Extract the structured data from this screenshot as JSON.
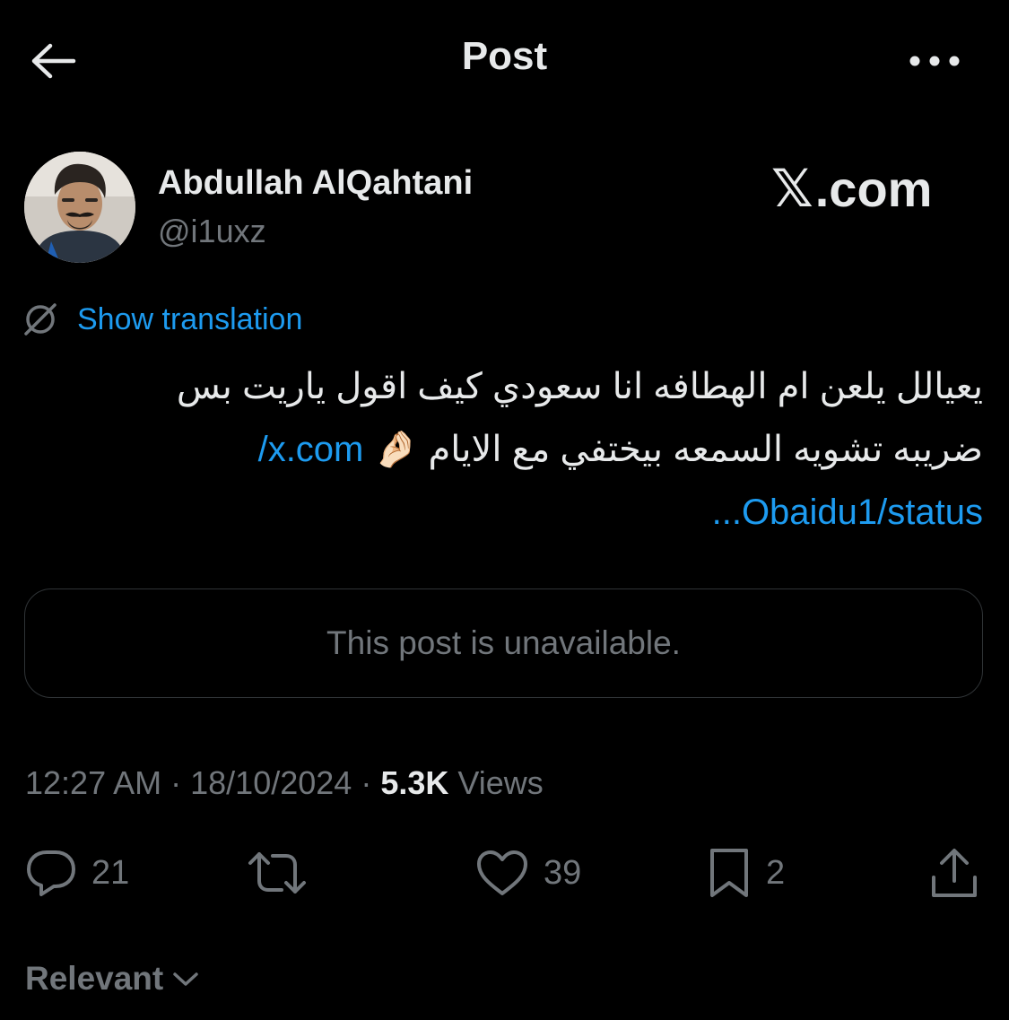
{
  "header": {
    "title": "Post",
    "back_icon": "arrow-left-icon",
    "more_icon": "more-horizontal-icon"
  },
  "author": {
    "name": "Abdullah AlQahtani",
    "handle": "@i1uxz"
  },
  "watermark": {
    "mark": "𝕏",
    "text": ".com"
  },
  "translation": {
    "label": "Show translation",
    "icon": "globe-icon"
  },
  "post": {
    "line1": "يعيالل يلعن ام الهطافه انا سعودي كيف اقول ياريت بس",
    "line2_text": "ضريبه تشويه السمعه بيختفي مع الايام",
    "emoji": "🤌🏻",
    "link_part1": "x.com/",
    "link_part2": "Obaidu1/status...",
    "unavailable": "This post is unavailable."
  },
  "meta": {
    "time": "12:27 AM",
    "separator": "·",
    "date": "18/10/2024",
    "views_count": "5.3K",
    "views_label": "Views"
  },
  "actions": {
    "replies": "21",
    "reposts": "",
    "likes": "39",
    "bookmarks": "2"
  },
  "sort": {
    "label": "Relevant"
  },
  "colors": {
    "background": "#000000",
    "text": "#e7e9ea",
    "secondary": "#71767b",
    "link": "#1d9bf0",
    "border": "#2f3336"
  }
}
